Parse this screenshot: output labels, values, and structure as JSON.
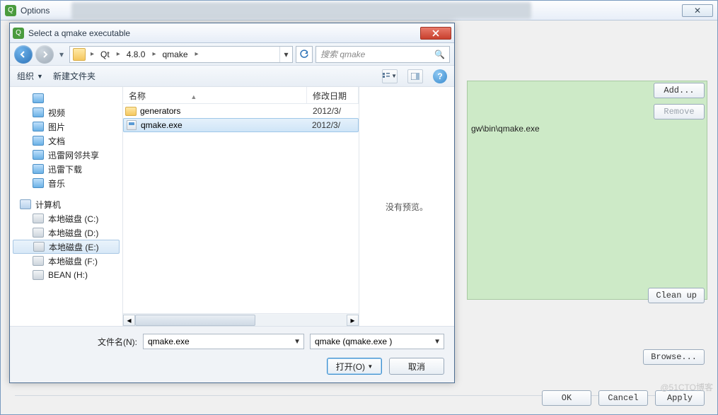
{
  "options": {
    "title": "Options",
    "close_glyph": "✕",
    "path_text": "gw\\bin\\qmake.exe",
    "buttons": {
      "add": "Add...",
      "remove": "Remove",
      "cleanup": "Clean up",
      "browse": "Browse..."
    },
    "footer": {
      "ok": "OK",
      "cancel": "Cancel",
      "apply": "Apply"
    },
    "watermark": "@51CTO博客"
  },
  "dialog": {
    "title": "Select a qmake executable",
    "breadcrumb": [
      "Qt",
      "4.8.0",
      "qmake"
    ],
    "search_placeholder": "搜索 qmake",
    "toolbar": {
      "organize": "组织",
      "new_folder": "新建文件夹"
    },
    "sidebar": {
      "quick": [
        {
          "label": "视频",
          "icon": "video"
        },
        {
          "label": "图片",
          "icon": "picture"
        },
        {
          "label": "文档",
          "icon": "document"
        },
        {
          "label": "迅雷网邻共享",
          "icon": "share"
        },
        {
          "label": "迅雷下载",
          "icon": "download"
        },
        {
          "label": "音乐",
          "icon": "music"
        }
      ],
      "computer_label": "计算机",
      "drives": [
        {
          "label": "本地磁盘 (C:)"
        },
        {
          "label": "本地磁盘 (D:)"
        },
        {
          "label": "本地磁盘 (E:)",
          "selected": true
        },
        {
          "label": "本地磁盘 (F:)"
        },
        {
          "label": "BEAN (H:)"
        }
      ]
    },
    "columns": {
      "name": "名称",
      "date": "修改日期"
    },
    "files": [
      {
        "name": "generators",
        "date": "2012/3/",
        "type": "folder",
        "selected": false
      },
      {
        "name": "qmake.exe",
        "date": "2012/3/",
        "type": "exe",
        "selected": true
      }
    ],
    "preview_empty": "没有预览。",
    "filename_label": "文件名(N):",
    "filename_value": "qmake.exe",
    "filter_value": "qmake (qmake.exe )",
    "open": "打开(O)",
    "cancel": "取消"
  }
}
